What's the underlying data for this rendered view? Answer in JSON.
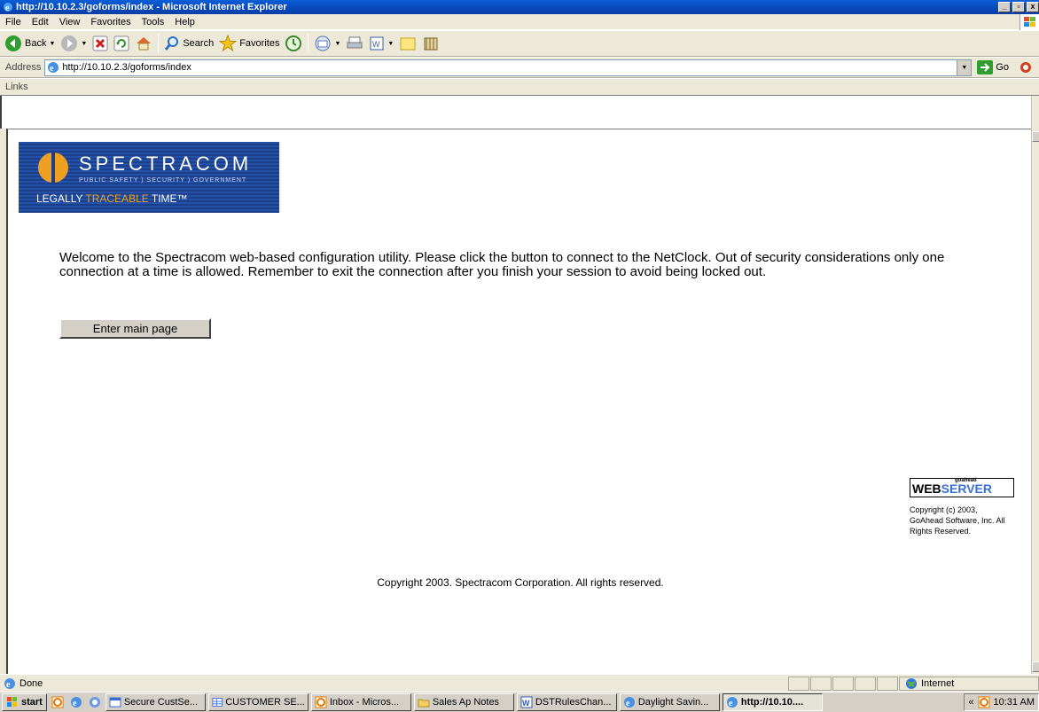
{
  "window": {
    "title": "http://10.10.2.3/goforms/index - Microsoft Internet Explorer",
    "minimize": "_",
    "restore": "▫",
    "close": "x"
  },
  "menu": [
    "File",
    "Edit",
    "View",
    "Favorites",
    "Tools",
    "Help"
  ],
  "toolbar": {
    "back": "Back",
    "search": "Search",
    "favorites": "Favorites"
  },
  "address": {
    "label": "Address",
    "url": "http://10.10.2.3/goforms/index",
    "go": "Go"
  },
  "links": {
    "label": "Links"
  },
  "page": {
    "logo": {
      "name": "SPECTRACOM",
      "subtitle": "PUBLIC SAFETY ) SECURITY ) GOVERNMENT",
      "tag_start": "LEGALLY ",
      "tag_highlight": "TRACEABLE",
      "tag_end": " TIME™"
    },
    "welcome": "Welcome to the Spectracom web-based configuration utility. Please click the button to connect to the NetClock. Out of security considerations only one connection at a time is allowed. Remember to exit the connection after you finish your session to avoid being locked out.",
    "enter_button": "Enter main page",
    "webserver_badge": {
      "top": "goahead",
      "part1": "WEB",
      "part2": "SERVER"
    },
    "webserver_copyright": "Copyright (c) 2003, GoAhead Software, Inc. All Rights Reserved.",
    "copyright": "Copyright 2003. Spectracom Corporation. All rights reserved."
  },
  "status": {
    "text": "Done",
    "zone": "Internet"
  },
  "taskbar": {
    "start": "start",
    "tasks": [
      {
        "label": "Secure CustSe...",
        "icon": "window-icon"
      },
      {
        "label": "CUSTOMER SE...",
        "icon": "table-icon"
      },
      {
        "label": "Inbox - Micros...",
        "icon": "outlook-icon"
      },
      {
        "label": "Sales Ap Notes",
        "icon": "folder-icon"
      },
      {
        "label": "DSTRulesChan...",
        "icon": "word-icon"
      },
      {
        "label": "Daylight Savin...",
        "icon": "ie-icon"
      },
      {
        "label": "http://10.10....",
        "icon": "ie-icon",
        "active": true
      }
    ],
    "tray_chevron": "«",
    "clock": "10:31 AM"
  },
  "colors": {
    "title_bar": "#0846b8",
    "logo_bg": "#1c3f8a",
    "logo_accent": "#f0a020",
    "chrome": "#ece9d8"
  }
}
